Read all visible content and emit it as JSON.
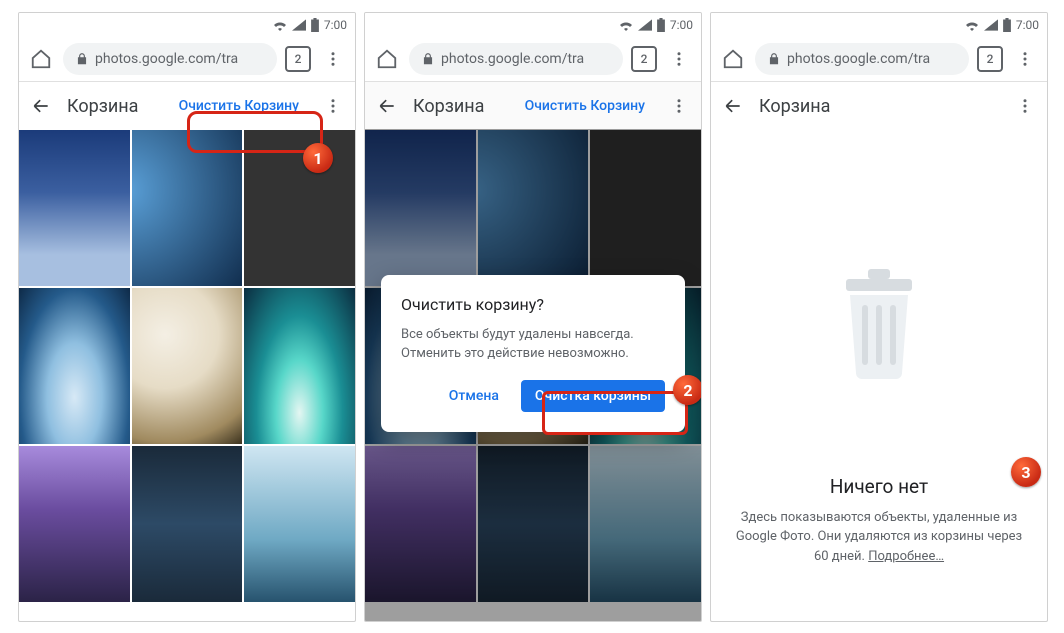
{
  "status": {
    "time": "7:00"
  },
  "browser": {
    "url": "photos.google.com/tra",
    "tab_count": "2"
  },
  "toolbar": {
    "title": "Корзина",
    "empty_trash_action": "Очистить Корзину"
  },
  "dialog": {
    "title": "Очистить корзину?",
    "body": "Все объекты будут удалены навсегда. Отменить это действие невозможно.",
    "cancel": "Отмена",
    "confirm": "Очистка корзины"
  },
  "empty_state": {
    "title": "Ничего нет",
    "body_prefix": "Здесь показываются объекты, удаленные из Google Фото. Они удаляются из корзины через 60 дней. ",
    "learn_more": "Подробнее…"
  },
  "callouts": {
    "1": "1",
    "2": "2",
    "3": "3"
  }
}
